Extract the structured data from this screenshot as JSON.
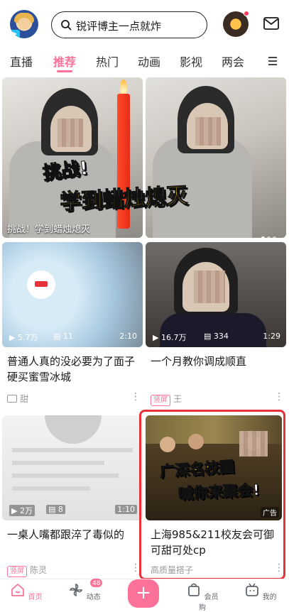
{
  "header": {
    "search_placeholder": "锐评博主一点就炸",
    "notification_dot_color": "#ff3a5c"
  },
  "tabs": [
    {
      "label": "直播",
      "active": false
    },
    {
      "label": "推荐",
      "active": true
    },
    {
      "label": "热门",
      "active": false
    },
    {
      "label": "动画",
      "active": false
    },
    {
      "label": "影视",
      "active": false
    },
    {
      "label": "两会",
      "active": false
    }
  ],
  "feed": {
    "banner": {
      "overlay_line1": "挑战!",
      "overlay_line2": "学到蜡烛熄灭",
      "caption": "挑战！学到蜡烛熄灭"
    },
    "cards": [
      {
        "views": "5.7万",
        "comments": "11",
        "duration": "2:10",
        "title": "普通人真的没必要为了面子硬买蜜雪冰城",
        "author": "甜"
      },
      {
        "views": "16.7万",
        "comments": "334",
        "duration": "1:29",
        "title": "一个月教你调成顺直",
        "tag": "竖屏",
        "author": "王"
      },
      {
        "views": "2万",
        "comments": "8",
        "duration": "1:10",
        "title": "一桌人嘴都跟淬了毒似的",
        "tag": "竖屏",
        "author": "陈灵"
      },
      {
        "overlay_line1": "广深名校圈",
        "overlay_line2": "喊你来聚会!",
        "ad_label": "广告",
        "title": "上海985&211校友会可御可甜可处cp",
        "author": "高质量搭子"
      }
    ]
  },
  "bottom_nav": [
    {
      "label": "首页",
      "active": true
    },
    {
      "label": "动态",
      "badge": "48"
    },
    {
      "label": "会员购"
    },
    {
      "label": "我的"
    }
  ],
  "colors": {
    "accent": "#fb7299",
    "highlight_border": "#e8323a"
  }
}
